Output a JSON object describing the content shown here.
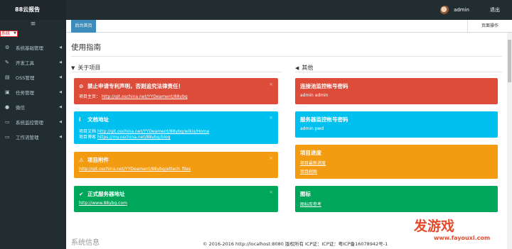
{
  "app": {
    "title": "88云报告"
  },
  "header": {
    "user": "admin",
    "logout": "退出"
  },
  "sidebar": {
    "system_select": "系统",
    "items": [
      {
        "label": "系统基础管理",
        "icon": "gears-icon"
      },
      {
        "label": "开发工具",
        "icon": "wrench-icon"
      },
      {
        "label": "OSS管理",
        "icon": "file-icon"
      },
      {
        "label": "任务管理",
        "icon": "tasks-icon"
      },
      {
        "label": "微信",
        "icon": "wechat-icon"
      },
      {
        "label": "系统监控管理",
        "icon": "monitor-icon"
      },
      {
        "label": "工作流管理",
        "icon": "workflow-icon"
      }
    ]
  },
  "tabs": {
    "home": "后台首页",
    "page_ops": "页面操作"
  },
  "main": {
    "title": "使用指南",
    "about_title": "关于项目",
    "other_title": "其他",
    "left_alerts": [
      {
        "title": "禁止申请专利声明，否则追究法律责任！",
        "line1": "项目主页：",
        "link1": "http://git.oschina.net/YYDeament/88ybg"
      },
      {
        "title": "文档地址",
        "line1": "项目文档",
        "link1": "http://git.oschina.net/YYDeament/88ybg/wikis/Home",
        "line2": "项目博客",
        "link2": "https://my.oschina.net/88ybg/blog"
      },
      {
        "title": "项目附件",
        "link1": "http://git.oschina.net/YYDeament/88ybg/attach_files"
      },
      {
        "title": "正式服务器地址",
        "link1": "http://www.88ybg.com"
      }
    ],
    "right_alerts": [
      {
        "title": "连接池监控帐号密码",
        "line1": "admin admin"
      },
      {
        "title": "服务器监控帐号密码",
        "line1": "admin pwd"
      },
      {
        "title": "项目进度",
        "link1": "项目最新进度",
        "link2": "项目树图"
      },
      {
        "title": "图标",
        "link1": "图标库参考"
      }
    ],
    "next_title": "系统信息"
  },
  "footer": {
    "text": "© 2016-2016 http://localhost:8080 版权所有 ICP证：ICP证：粤ICP备16078942号-1"
  },
  "watermark": {
    "main": "发游戏",
    "url": "www.fayouxi.com"
  },
  "colors": {
    "red": "#dd4b39",
    "aqua": "#00c0ef",
    "orange": "#f39c12",
    "green": "#00a65a",
    "primary": "#3c8dbc"
  }
}
